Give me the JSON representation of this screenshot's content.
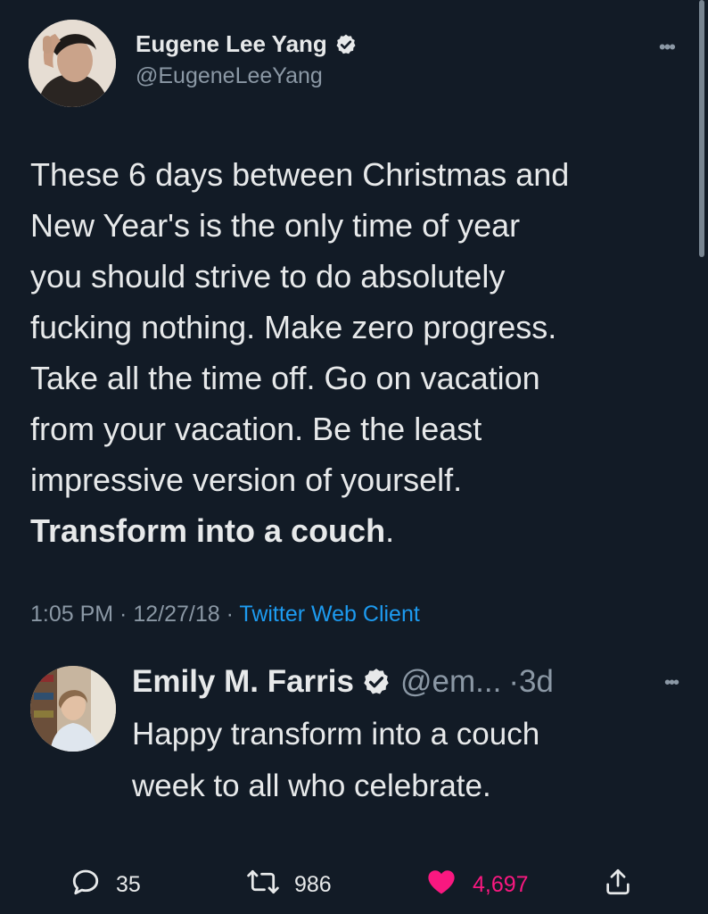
{
  "tweet": {
    "author_name": "Eugene Lee Yang",
    "author_handle": "@EugeneLeeYang",
    "verified": true,
    "body_lines": [
      "These 6 days between Christmas and",
      "New Year's is the only time of year",
      "you should strive to do absolutely",
      "fucking nothing. Make zero progress.",
      "Take all the time off. Go on vacation",
      "from your vacation. Be the least",
      "impressive version of yourself."
    ],
    "body_bold": "Transform into a couch",
    "body_bold_suffix": ".",
    "time": "1:05 PM",
    "sep1": " · ",
    "date": "12/27/18",
    "sep2": " · ",
    "client": "Twitter Web Client",
    "more_icon": "more-horizontal-icon"
  },
  "quote": {
    "author_name": "Emily M. Farris",
    "verified": true,
    "handle": "@em...",
    "time": "·3d",
    "text_lines": [
      "Happy transform into a couch",
      "week to all who celebrate."
    ]
  },
  "actions": {
    "reply_count": "35",
    "retweet_count": "986",
    "like_count": "4,697",
    "like_color": "#f91880",
    "accent": "#1d9bf0"
  }
}
